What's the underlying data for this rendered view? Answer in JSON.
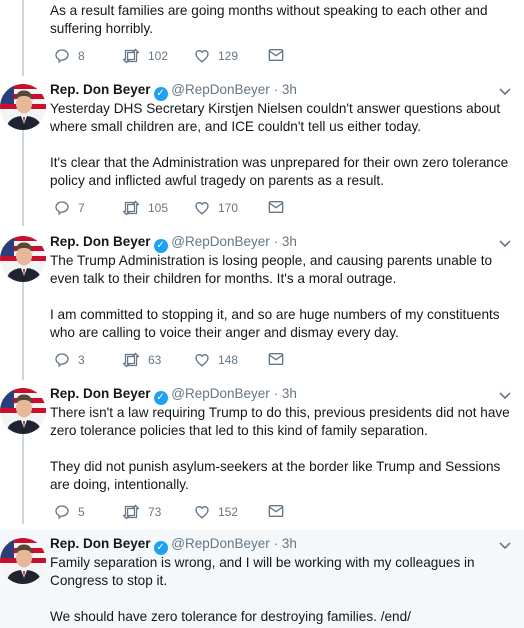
{
  "top_tweet": {
    "text": "As a result families are going months without speaking to each other and suffering horribly.",
    "replies": "8",
    "retweets": "102",
    "likes": "129"
  },
  "tweets": [
    {
      "name": "Rep. Don Beyer",
      "handle": "@RepDonBeyer",
      "dot": "·",
      "time": "3h",
      "p1": "Yesterday DHS Secretary Kirstjen Nielsen couldn't answer questions about where small children are, and ICE couldn't tell us either today.",
      "p2": "It's clear that the Administration was unprepared for their own zero tolerance policy and inflicted awful tragedy on parents as a result.",
      "replies": "7",
      "retweets": "105",
      "likes": "170"
    },
    {
      "name": "Rep. Don Beyer",
      "handle": "@RepDonBeyer",
      "dot": "·",
      "time": "3h",
      "p1": "The Trump Administration is losing people, and causing parents unable to even talk to their children for months. It's a moral outrage.",
      "p2": "I am committed to stopping it, and so are huge numbers of my constituents who are calling to voice their anger and dismay every day.",
      "replies": "3",
      "retweets": "63",
      "likes": "148"
    },
    {
      "name": "Rep. Don Beyer",
      "handle": "@RepDonBeyer",
      "dot": "·",
      "time": "3h",
      "p1": "There isn't a law requiring Trump to do this, previous presidents did not have zero tolerance policies that led to this kind of family separation.",
      "p2": "They did not punish asylum-seekers at the border like Trump and Sessions are doing, intentionally.",
      "replies": "5",
      "retweets": "73",
      "likes": "152"
    },
    {
      "name": "Rep. Don Beyer",
      "handle": "@RepDonBeyer",
      "dot": "·",
      "time": "3h",
      "p1": "Family separation is wrong, and I will be working with my colleagues in Congress to stop it.",
      "p2": "We should have zero tolerance for destroying families. /end/"
    }
  ],
  "colors": {
    "accent": "#1da1f2",
    "muted": "#657786",
    "thread": "#ccd6dd",
    "highlight_bg": "#f5f8fa"
  }
}
